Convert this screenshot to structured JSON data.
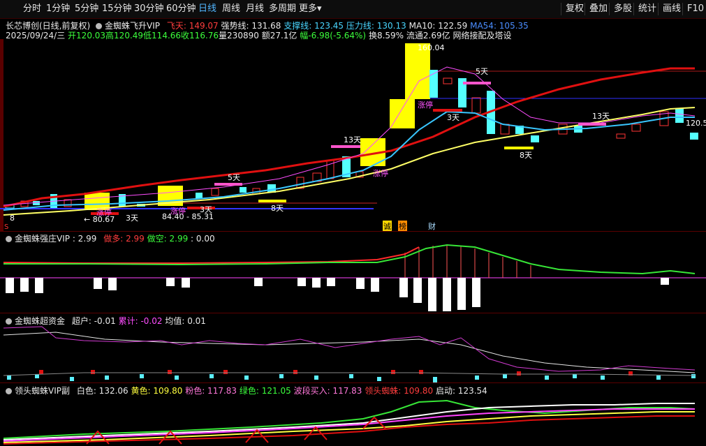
{
  "toolbar": {
    "tabs": [
      "分时",
      "1分钟",
      "5分钟",
      "15分钟",
      "30分钟",
      "60分钟",
      "日线",
      "周线",
      "月线",
      "多周期",
      "更多▾"
    ],
    "active_tab": "日线",
    "right_buttons": [
      "复权",
      "叠加",
      "多股",
      "统计",
      "画线",
      "F10"
    ]
  },
  "main": {
    "title": "长芯博创(日线,前复权)",
    "indicator_name": "金蜘蛛飞升VIP",
    "fly_label": "飞天: 149.07",
    "strong_label": "强势线: 131.68",
    "support_label": "支撑线: 123.45",
    "pressure_label": "压力线: 130.13",
    "ma10_label": "MA10: 122.59",
    "ma54_label": "MA54: 105.35",
    "date_line": "2025/09/24/三",
    "open": "开120.03",
    "high": "高120.49",
    "low": "低114.66",
    "close": "收116.76",
    "vol": "量230890",
    "amount": "额27.1亿",
    "change": "幅-6.98(-5.64%)",
    "turnover": "换8.59%",
    "float": "流通2.69亿",
    "concept": "网络接配及塔设",
    "annotations": {
      "high_price": "160.04",
      "price_120": "120.5",
      "low_label_1": "← 80.67",
      "low_label_2": "84.40 - 85.31",
      "days_5a": "5天",
      "days_5b": "5天",
      "days_3a": "3天",
      "days_3b": "3天",
      "days_3c": "3天",
      "days_8a": "8天",
      "days_8b": "8天",
      "days_13a": "13天",
      "days_13b": "13天",
      "limit_up_1": "涨停",
      "limit_up_2": "涨停",
      "limit_up_3": "涨停",
      "limit_up_4": "涨停",
      "left_small": "8",
      "s_marker": "S"
    },
    "event_tags": [
      "诚",
      "榜",
      "财"
    ]
  },
  "panel2": {
    "name": "金蜘蛛强庄VIP",
    "value": ": 2.99",
    "do_more": "做多: 2.99",
    "do_short": "做空: 2.99",
    "extra": ": 0.00"
  },
  "panel3": {
    "name": "金蜘蛛超资金",
    "super": "超户: -0.01",
    "accum": "累计: -0.02",
    "avg": "均值: 0.01"
  },
  "panel4": {
    "name": "领头蜘蛛VIP副",
    "white": "白色: 132.06",
    "yellow": "黄色: 109.80",
    "pink": "粉色: 117.83",
    "green": "绿色: 121.05",
    "wave_buy": "波段买入: 117.83",
    "lead": "领头蜘蛛: 109.80",
    "start": "启动: 123.54"
  },
  "colors": {
    "up": "#ff3333",
    "down": "#54ffff",
    "limit_box": "#ffff00",
    "ma_red": "#e01010",
    "ma_yellow": "#ffff66",
    "ma_cyan": "#39c6ff",
    "ma_pink": "#ff4dff"
  }
}
